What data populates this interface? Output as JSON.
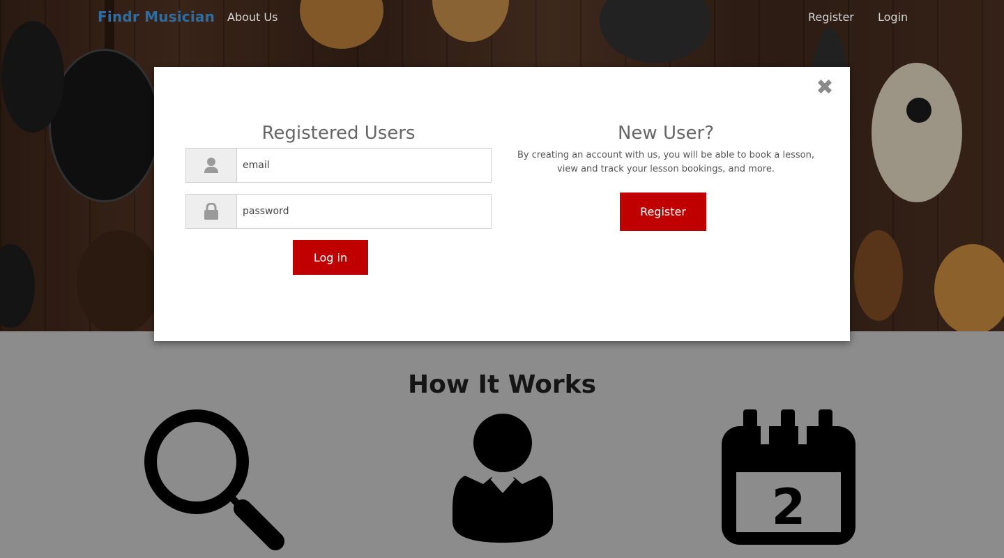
{
  "nav": {
    "brand": "Findr Musician",
    "about": "About Us",
    "register": "Register",
    "login": "Login"
  },
  "modal": {
    "close_glyph": "✖",
    "registered": {
      "title": "Registered Users",
      "email_placeholder": "email",
      "password_placeholder": "password",
      "login_button": "Log in"
    },
    "new_user": {
      "title": "New User?",
      "description": "By creating an account with us, you will be able to book a lesson, view and track your lesson bookings, and more.",
      "register_button": "Register"
    }
  },
  "how_it_works": {
    "title": "How It Works",
    "calendar_day": "2",
    "icons": [
      "search-icon",
      "user-icon",
      "calendar-icon"
    ]
  },
  "colors": {
    "brand": "#2d6da3",
    "accent": "#c00000",
    "lower_bg": "#8c8c8c"
  }
}
